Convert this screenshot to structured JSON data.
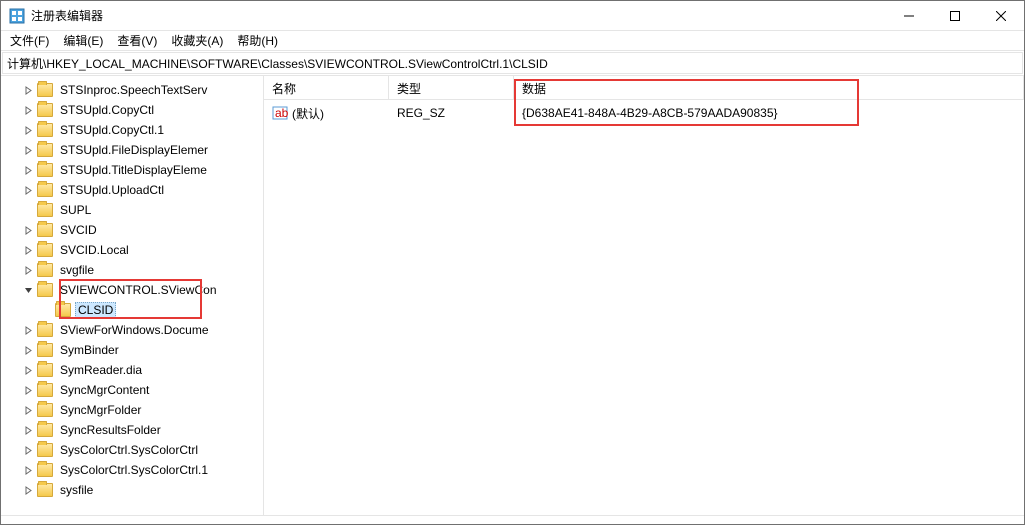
{
  "window": {
    "title": "注册表编辑器"
  },
  "menu": {
    "file": "文件(F)",
    "edit": "编辑(E)",
    "view": "查看(V)",
    "favorites": "收藏夹(A)",
    "help": "帮助(H)"
  },
  "address": "计算机\\HKEY_LOCAL_MACHINE\\SOFTWARE\\Classes\\SVIEWCONTROL.SViewControlCtrl.1\\CLSID",
  "tree": [
    {
      "label": "STSInproc.SpeechTextServ",
      "expandable": true
    },
    {
      "label": "STSUpld.CopyCtl",
      "expandable": true
    },
    {
      "label": "STSUpld.CopyCtl.1",
      "expandable": true
    },
    {
      "label": "STSUpld.FileDisplayElemer",
      "expandable": true
    },
    {
      "label": "STSUpld.TitleDisplayEleme",
      "expandable": true
    },
    {
      "label": "STSUpld.UploadCtl",
      "expandable": true
    },
    {
      "label": "SUPL",
      "expandable": false
    },
    {
      "label": "SVCID",
      "expandable": true
    },
    {
      "label": "SVCID.Local",
      "expandable": true
    },
    {
      "label": "svgfile",
      "expandable": true
    },
    {
      "label": "SVIEWCONTROL.SViewCon",
      "expandable": true,
      "expanded": true,
      "child": {
        "label": "CLSID",
        "selected": true
      }
    },
    {
      "label": "SViewForWindows.Docume",
      "expandable": true
    },
    {
      "label": "SymBinder",
      "expandable": true
    },
    {
      "label": "SymReader.dia",
      "expandable": true
    },
    {
      "label": "SyncMgrContent",
      "expandable": true
    },
    {
      "label": "SyncMgrFolder",
      "expandable": true
    },
    {
      "label": "SyncResultsFolder",
      "expandable": true
    },
    {
      "label": "SysColorCtrl.SysColorCtrl",
      "expandable": true
    },
    {
      "label": "SysColorCtrl.SysColorCtrl.1",
      "expandable": true
    },
    {
      "label": "sysfile",
      "expandable": true
    }
  ],
  "list": {
    "headers": {
      "name": "名称",
      "type": "类型",
      "data": "数据"
    },
    "rows": [
      {
        "name": "(默认)",
        "type": "REG_SZ",
        "data": "{D638AE41-848A-4B29-A8CB-579AADA90835}"
      }
    ]
  }
}
